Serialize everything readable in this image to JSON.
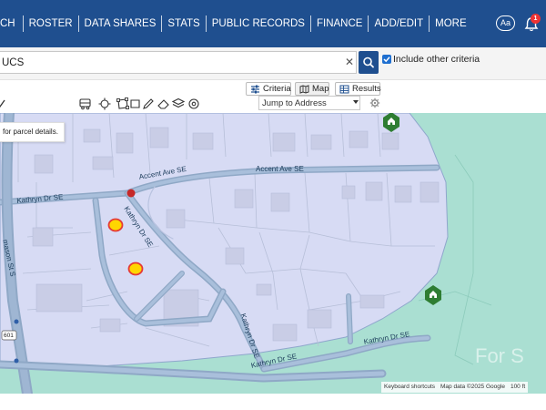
{
  "nav": {
    "tabs": [
      {
        "label": "CH"
      },
      {
        "label": "ROSTER"
      },
      {
        "label": "DATA SHARES"
      },
      {
        "label": "STATS"
      },
      {
        "label": "PUBLIC RECORDS"
      },
      {
        "label": "FINANCE"
      },
      {
        "label": "ADD/EDIT"
      },
      {
        "label": "MORE"
      }
    ],
    "font_button": "Aa",
    "notification_count": "1",
    "bell_icon": "bell-icon"
  },
  "search": {
    "value": "UCS",
    "clear_icon": "close-icon",
    "search_icon": "search-icon",
    "include_other_label": "Include other criteria",
    "include_other_checked": true
  },
  "toolbar": {
    "view_tabs": [
      {
        "label": "Criteria",
        "icon": "sliders-icon"
      },
      {
        "label": "Map",
        "icon": "map-icon",
        "selected": true
      },
      {
        "label": "Results",
        "icon": "grid-icon"
      }
    ],
    "jump_placeholder": "Jump to Address",
    "tools": [
      "bus-icon",
      "move-icon",
      "polygon-icon",
      "pencil-icon",
      "eraser-icon",
      "layers-icon",
      "target-icon"
    ],
    "settings_icon": "gear-icon"
  },
  "map": {
    "tooltip": "for parcel details.",
    "road_labels": {
      "accent_1": "Accent Ave SE",
      "accent_2": "Accent Ave SE",
      "kathryn_1": "Kathryn Dr SE",
      "kathryn_2": "Kathryn Dr SE",
      "kathryn_3": "Kathryn Dr SE",
      "kathryn_4": "Kathryn Dr SE",
      "kathryn_5": "Kathryn Dr SE",
      "vertical": "mason St S",
      "shield": "601"
    },
    "attribution": {
      "shortcuts": "Keyboard shortcuts",
      "data": "Map data ©2025 Google",
      "scale": "100 ft"
    },
    "watermark": "For S",
    "colors": {
      "water": "#aadfd2",
      "overlay": "#d7dbf4",
      "road": "#8fa8c6",
      "listing_marker": "#ffd600",
      "listing_border": "#e53935",
      "home_marker": "#2e7d32"
    }
  }
}
